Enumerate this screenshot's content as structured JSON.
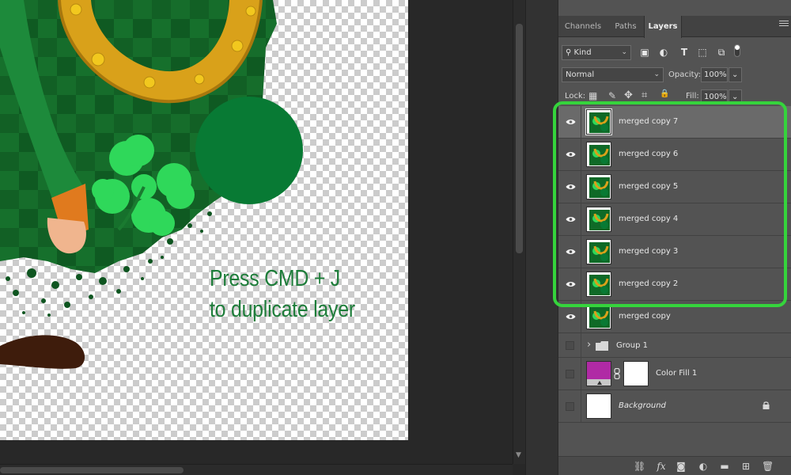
{
  "canvas": {
    "annotation_line1": "Press CMD + J",
    "annotation_line2": "to duplicate layer",
    "annotation_color": "#1e7d3a"
  },
  "panel": {
    "tabs": [
      {
        "label": "Channels",
        "active": false
      },
      {
        "label": "Paths",
        "active": false
      },
      {
        "label": "Layers",
        "active": true
      }
    ],
    "filter_kind": "Kind",
    "blend_mode": "Normal",
    "opacity_label": "Opacity:",
    "opacity_value": "100%",
    "lock_label": "Lock:",
    "fill_label": "Fill:",
    "fill_value": "100%",
    "filter_icons": [
      "image-filter-icon",
      "adjustment-filter-icon",
      "type-filter-icon",
      "shape-filter-icon",
      "smart-object-filter-icon",
      "filter-toggle-icon"
    ],
    "lock_icons": [
      "lock-transparent-icon",
      "lock-image-icon",
      "lock-position-icon",
      "lock-artboard-icon",
      "lock-all-icon"
    ],
    "highlight_color": "#35d43c"
  },
  "layers": [
    {
      "name": "merged copy 7",
      "visible": true,
      "selected": true
    },
    {
      "name": "merged copy 6",
      "visible": true,
      "selected": false
    },
    {
      "name": "merged copy 5",
      "visible": true,
      "selected": false
    },
    {
      "name": "merged copy 4",
      "visible": true,
      "selected": false
    },
    {
      "name": "merged copy 3",
      "visible": true,
      "selected": false
    },
    {
      "name": "merged copy 2",
      "visible": true,
      "selected": false
    },
    {
      "name": "merged copy",
      "visible": true,
      "selected": false
    },
    {
      "name": "Group 1",
      "visible": false,
      "type": "group"
    },
    {
      "name": "Color Fill 1",
      "visible": false,
      "type": "fill",
      "fill_color": "#b02aa5"
    },
    {
      "name": "Background",
      "visible": false,
      "type": "background",
      "locked": true
    }
  ],
  "bottom_icons": [
    "link-layers-icon",
    "fx-icon",
    "add-mask-icon",
    "adjustment-layer-icon",
    "new-group-icon",
    "new-layer-icon",
    "delete-layer-icon"
  ],
  "bottom_fx_label": "fx",
  "icon_glyphs": {
    "menu_arrow": "⌄",
    "group_chevron": "›",
    "lock_transparent": "▦",
    "lock_image": "✎",
    "lock_position": "✥",
    "lock_artboard": "⌗",
    "lock_all": "🔒"
  }
}
